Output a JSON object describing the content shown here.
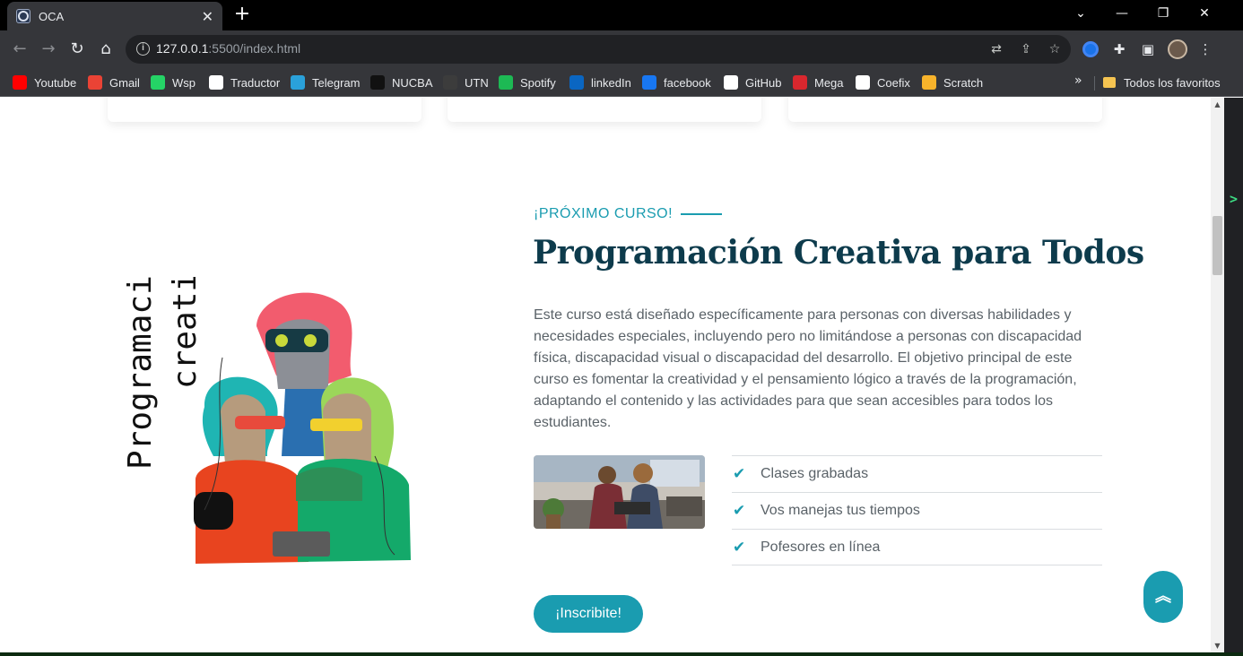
{
  "browser": {
    "tab_title": "OCA",
    "tab_close": "✕",
    "new_tab": "+",
    "url_host": "127.0.0.1",
    "url_rest": ":5500/index.html",
    "window_controls": {
      "chevron": "⌄",
      "minimize": "—",
      "restore": "❐",
      "close": "✕"
    },
    "bookmarks": [
      {
        "label": "Youtube",
        "icon": "youtube-icon",
        "color": "#ff0000"
      },
      {
        "label": "Gmail",
        "icon": "gmail-icon",
        "color": "#ea4335"
      },
      {
        "label": "Wsp",
        "icon": "whatsapp-icon",
        "color": "#25d366"
      },
      {
        "label": "Traductor",
        "icon": "google-icon",
        "color": "#ffffff"
      },
      {
        "label": "Telegram",
        "icon": "telegram-icon",
        "color": "#2aa1da"
      },
      {
        "label": "NUCBA",
        "icon": "nucba-icon",
        "color": "#111111"
      },
      {
        "label": "UTN",
        "icon": "utn-icon",
        "color": "#3c3c3c"
      },
      {
        "label": "Spotify",
        "icon": "spotify-icon",
        "color": "#1db954"
      },
      {
        "label": "linkedIn",
        "icon": "linkedin-icon",
        "color": "#0a66c2"
      },
      {
        "label": "facebook",
        "icon": "facebook-icon",
        "color": "#1877f2"
      },
      {
        "label": "GitHub",
        "icon": "github-icon",
        "color": "#ffffff"
      },
      {
        "label": "Mega",
        "icon": "mega-icon",
        "color": "#d9272e"
      },
      {
        "label": "Coefix",
        "icon": "coefix-icon",
        "color": "#ffffff"
      },
      {
        "label": "Scratch",
        "icon": "scratch-icon",
        "color": "#f7b32b"
      }
    ],
    "bookmarks_more": "»",
    "all_bookmarks": "Todos los favoritos"
  },
  "page": {
    "eyebrow": "¡PRÓXIMO CURSO!",
    "title": "Programación Creativa para Todos",
    "illustration_text_1": "Programación",
    "illustration_text_2": "creativa",
    "description": "Este curso está diseñado específicamente para personas con diversas habilidades y necesidades especiales, incluyendo pero no limitándose a personas con discapacidad física, discapacidad visual o discapacidad del desarrollo. El objetivo principal de este curso es fomentar la creatividad y el pensamiento lógico a través de la programación, adaptando el contenido y las actividades para que sean accesibles para todos los estudiantes.",
    "features": [
      {
        "label": "Clases grabadas",
        "icon": "check-icon"
      },
      {
        "label": "Vos manejas tus tiempos",
        "icon": "check-icon"
      },
      {
        "label": "Pofesores en línea",
        "icon": "check-icon"
      }
    ],
    "cta_label": "¡Inscribite!",
    "accent_color": "#1a9cb0",
    "title_color": "#0d3b4c"
  }
}
